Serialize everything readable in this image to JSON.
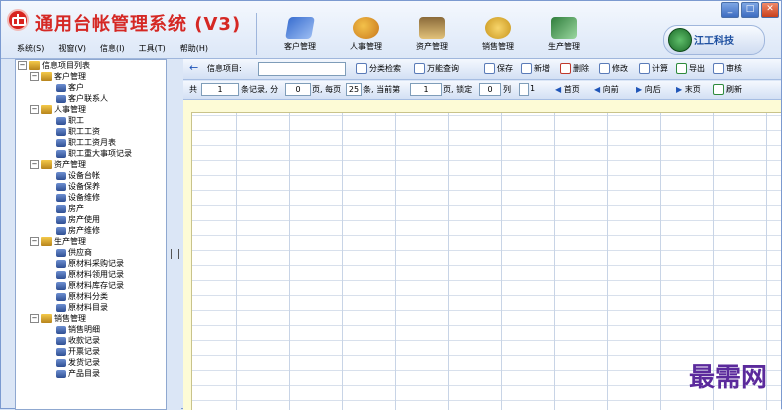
{
  "title": "通用台帐管理系统 (V3)",
  "window_buttons": [
    "_",
    "□",
    "✕"
  ],
  "menu": [
    "系统(S)",
    "视窗(V)",
    "信息(I)",
    "工具(T)",
    "帮助(H)"
  ],
  "modules": [
    {
      "label": "客户管理",
      "icon": "customer-icon"
    },
    {
      "label": "人事管理",
      "icon": "hr-icon"
    },
    {
      "label": "资产管理",
      "icon": "asset-icon"
    },
    {
      "label": "销售管理",
      "icon": "sales-icon"
    },
    {
      "label": "生产管理",
      "icon": "production-icon"
    }
  ],
  "brand": "江工科技",
  "tree": {
    "root": "信息项目列表",
    "groups": [
      {
        "label": "客户管理",
        "items": [
          "客户",
          "客户联系人"
        ]
      },
      {
        "label": "人事管理",
        "items": [
          "职工",
          "职工工资",
          "职工工资月表",
          "职工重大事项记录"
        ]
      },
      {
        "label": "资产管理",
        "items": [
          "设备台帐",
          "设备保养",
          "设备维修",
          "房产",
          "房产使用",
          "房产维修"
        ]
      },
      {
        "label": "生产管理",
        "items": [
          "供应商",
          "原材料采购记录",
          "原材料领用记录",
          "原材料库存记录",
          "原材料分类",
          "原材料目录"
        ]
      },
      {
        "label": "销售管理",
        "items": [
          "销售明细",
          "收款记录",
          "开票记录",
          "发货记录",
          "产品目录"
        ]
      }
    ]
  },
  "toolbar": {
    "back": "←",
    "info_label": "信息项目:",
    "info_value": "",
    "classify": "分类检索",
    "universal": "万能查询",
    "save": "保存",
    "new": "新增",
    "delete": "删除",
    "modify": "修改",
    "calc": "计算",
    "export": "导出",
    "audit": "审核"
  },
  "pager": {
    "total_prefix": "共",
    "total": "1",
    "records_label": "条记录, 分",
    "pages": "0",
    "pages_label": "页, 每页",
    "per_page": "25",
    "per_page_label": "条, 当前第",
    "current": "1",
    "current_label": "页, 锁定",
    "lock": "0",
    "lock_label": "列",
    "checkbox_label": "1",
    "first": "首页",
    "prev": "向前",
    "next": "向后",
    "last": "末页",
    "refresh": "刷新"
  },
  "watermark": "最需网"
}
